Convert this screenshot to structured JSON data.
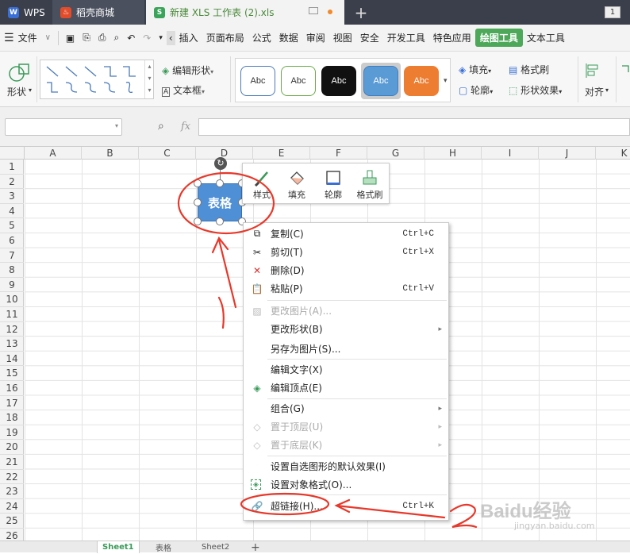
{
  "titlebar": {
    "app_tab": "WPS",
    "store_tab": "稻壳商城",
    "doc_tab": "新建 XLS 工作表 (2).xls",
    "new_tab": "+",
    "window_count": "1"
  },
  "menubar": {
    "file": "文件",
    "items": [
      "插入",
      "页面布局",
      "公式",
      "数据",
      "审阅",
      "视图",
      "安全",
      "开发工具",
      "特色应用",
      "绘图工具",
      "文本工具"
    ]
  },
  "ribbon": {
    "shape_label": "形状",
    "edit_shape": "编辑形状",
    "textbox": "文本框",
    "styles": [
      {
        "label": "Abc",
        "bg": "#ffffff",
        "border": "#4a7ab8",
        "color": "#333333"
      },
      {
        "label": "Abc",
        "bg": "#ffffff",
        "border": "#6aaa4a",
        "color": "#333333"
      },
      {
        "label": "Abc",
        "bg": "#111111",
        "border": "#111111",
        "color": "#ffffff"
      },
      {
        "label": "Abc",
        "bg": "#5b9bd5",
        "border": "#3f7ec0",
        "color": "#ffffff"
      },
      {
        "label": "Abc",
        "bg": "#ed7d31",
        "border": "#c9601c",
        "color": "#ffffff"
      }
    ],
    "fill": "填充",
    "format_painter": "格式刷",
    "outline": "轮廓",
    "shape_effect": "形状效果",
    "align": "对齐"
  },
  "formula": {
    "fx": "fx"
  },
  "columns": [
    "A",
    "B",
    "C",
    "D",
    "E",
    "F",
    "G",
    "H",
    "I",
    "J",
    "K"
  ],
  "rows": [
    "1",
    "2",
    "3",
    "4",
    "5",
    "6",
    "7",
    "8",
    "9",
    "10",
    "11",
    "12",
    "13",
    "14",
    "15",
    "16",
    "17",
    "18",
    "19",
    "20",
    "21",
    "22",
    "23",
    "24",
    "25",
    "26"
  ],
  "shape": {
    "text": "表格",
    "color": "#4f8fd6"
  },
  "mini_toolbar": [
    "样式",
    "填充",
    "轮廓",
    "格式刷"
  ],
  "context_menu": {
    "copy": {
      "label": "复制(C)",
      "shortcut": "Ctrl+C"
    },
    "cut": {
      "label": "剪切(T)",
      "shortcut": "Ctrl+X"
    },
    "delete": {
      "label": "删除(D)"
    },
    "paste": {
      "label": "粘贴(P)",
      "shortcut": "Ctrl+V"
    },
    "change_picture": {
      "label": "更改图片(A)..."
    },
    "change_shape": {
      "label": "更改形状(B)"
    },
    "save_as_picture": {
      "label": "另存为图片(S)..."
    },
    "edit_text": {
      "label": "编辑文字(X)"
    },
    "edit_points": {
      "label": "编辑顶点(E)"
    },
    "group": {
      "label": "组合(G)"
    },
    "bring_to_front": {
      "label": "置于顶层(U)"
    },
    "send_to_back": {
      "label": "置于底层(K)"
    },
    "set_default": {
      "label": "设置自选图形的默认效果(I)"
    },
    "format_object": {
      "label": "设置对象格式(O)..."
    },
    "hyperlink": {
      "label": "超链接(H)...",
      "shortcut": "Ctrl+K"
    }
  },
  "sheets": [
    "Sheet1",
    "表格",
    "Sheet2"
  ],
  "watermark": "Baidu经验",
  "watermark_sub": "jingyan.baidu.com",
  "annotation_color": "#e8382a"
}
